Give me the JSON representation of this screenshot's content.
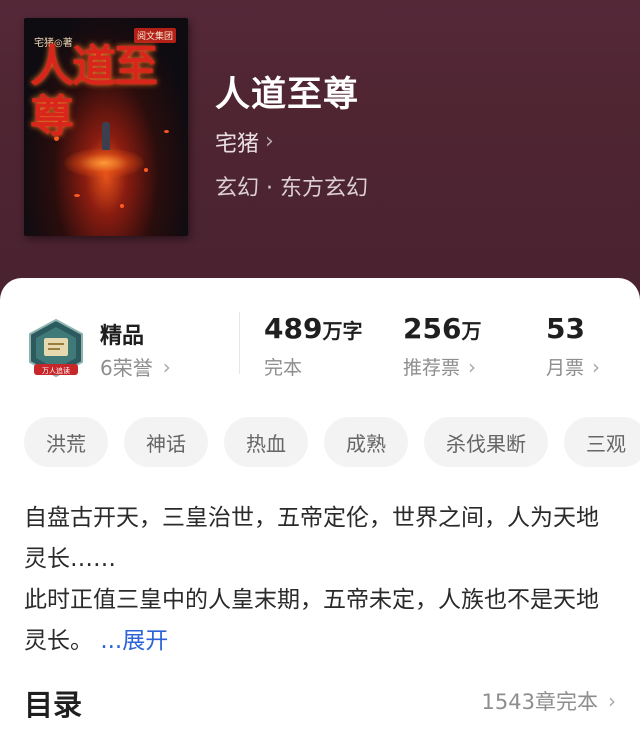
{
  "book": {
    "title": "人道至尊",
    "author": "宅猪",
    "genre": "玄幻 · 东方玄幻",
    "cover": {
      "title_text": "人道至尊",
      "author_text": "宅猪◎著",
      "publisher_text": "阅文集团"
    }
  },
  "quality": {
    "label": "精品",
    "honors": "6荣誉",
    "badge_text": "万人追读"
  },
  "stats": [
    {
      "value": "489",
      "unit": "万字",
      "label": "完本"
    },
    {
      "value": "256",
      "unit": "万",
      "label": "推荐票"
    },
    {
      "value": "53",
      "unit": "",
      "label": "月票"
    }
  ],
  "tags": [
    "洪荒",
    "神话",
    "热血",
    "成熟",
    "杀伐果断",
    "三观"
  ],
  "synopsis": {
    "text": "自盘古开天，三皇治世，五帝定伦，世界之间，人为天地灵长……\n此时正值三皇中的人皇末期，五帝未定，人族也不是天地灵长。",
    "expand_label": "...展开"
  },
  "toc": {
    "title": "目录",
    "status": "1543章完本"
  },
  "icons": {
    "chevron": "chevron-right-icon"
  },
  "colors": {
    "header_bg": "#4f2532",
    "accent_link": "#2d63d8",
    "tag_bg": "#f3f3f3"
  }
}
